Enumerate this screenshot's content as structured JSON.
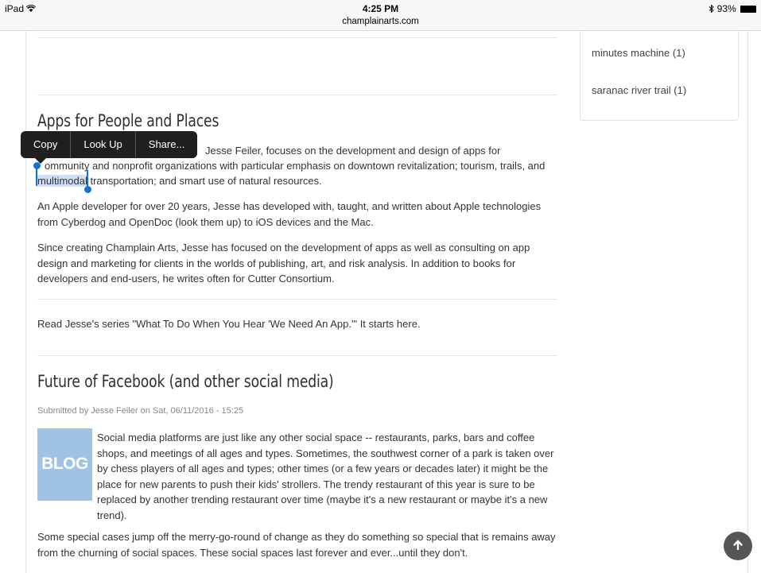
{
  "status_bar": {
    "device": "iPad",
    "wifi_icon": "wifi-icon",
    "time": "4:25 PM",
    "url": "champlainarts.com",
    "bluetooth_icon": "bluetooth-icon",
    "battery": "93%"
  },
  "sidebar": {
    "links": [
      {
        "label": "minutes machine (1)"
      },
      {
        "label": "saranac river trail (1)"
      }
    ]
  },
  "edit_menu": {
    "items": [
      {
        "label": "Copy"
      },
      {
        "label": "Look Up"
      },
      {
        "label": "Share..."
      }
    ]
  },
  "article1": {
    "title": "Apps for People and Places",
    "p1_line1": "Jesse Feiler,  focuses on the development and design of apps for",
    "p1_line2": "ommunity and nonprofit organizations with particular emphasis on downtown revitalization; tourism, trails, and",
    "p1_selected": "multimodal",
    "p1_line3_rest": " transportation; and smart use of natural resources.",
    "p2": "An Apple developer for over 20 years, Jesse has developed with, taught, and written about Apple technologies from Cyberdog and OpenDoc (look them up) to iOS devices and the Mac.",
    "p3": "Since creating Champlain Arts, Jesse has focused on the development of apps as well as consulting on app design and marketing for clients in the worlds of publishing, art, and risk analysis. In addition to books for developers and end-users, he writes often for Cutter Consortium.",
    "read_more": "Read Jesse's series \"What To Do When You Hear 'We Need An App.'\" It starts here."
  },
  "article2": {
    "title": "Future of Facebook (and other social media)",
    "meta": "Submitted by Jesse Feiler on Sat, 06/11/2016 - 15:25",
    "image_label": "BLOG",
    "p1": "Social media platforms are just like any other social space -- restaurants, parks, bars and coffee shops, and meetings of all ages and types. Sometimes, the southwest corner of a park is taken over by chess players of all ages and types; other times (or a few years or decades later) it might be the place for new parents to push their kids' strollers. The trendy restaurant of this year is sure to be replaced by another trending restaurant over time (maybe it's a new restaurant or maybe it's a new trend).",
    "p2": "Some special cases jump off the merry-go-round of change as they do something so special that is remains away from the churning of social spaces. These social spaces last forever and ever...until they don't."
  },
  "scroll_top_icon": "arrow-up-icon"
}
